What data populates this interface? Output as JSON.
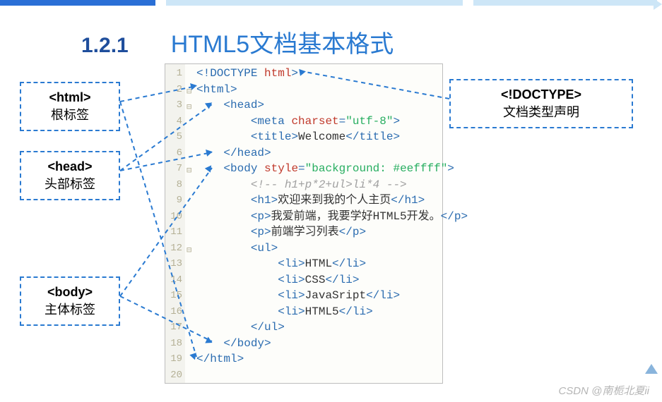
{
  "header": {
    "section_number": "1.2.1",
    "title": "HTML5文档基本格式"
  },
  "callouts": {
    "html": {
      "tag": "<html>",
      "desc": "根标签"
    },
    "head": {
      "tag": "<head>",
      "desc": "头部标签"
    },
    "body": {
      "tag": "<body>",
      "desc": "主体标签"
    },
    "doctype": {
      "tag": "<!DOCTYPE>",
      "desc": "文档类型声明"
    }
  },
  "code": {
    "line_count": 20,
    "fold_markers": [
      2,
      3,
      7,
      12
    ],
    "lines": [
      [
        {
          "c": "t-punc",
          "t": "<!"
        },
        {
          "c": "t-doc",
          "t": "DOCTYPE "
        },
        {
          "c": "t-attr",
          "t": "html"
        },
        {
          "c": "t-punc",
          "t": ">"
        }
      ],
      [
        {
          "c": "t-punc",
          "t": "<"
        },
        {
          "c": "t-tag",
          "t": "html"
        },
        {
          "c": "t-punc",
          "t": ">"
        }
      ],
      [
        {
          "c": "",
          "t": "    "
        },
        {
          "c": "t-punc",
          "t": "<"
        },
        {
          "c": "t-tag",
          "t": "head"
        },
        {
          "c": "t-punc",
          "t": ">"
        }
      ],
      [
        {
          "c": "",
          "t": "        "
        },
        {
          "c": "t-punc",
          "t": "<"
        },
        {
          "c": "t-tag",
          "t": "meta "
        },
        {
          "c": "t-attr",
          "t": "charset"
        },
        {
          "c": "t-punc",
          "t": "="
        },
        {
          "c": "t-str",
          "t": "\"utf-8\""
        },
        {
          "c": "t-punc",
          "t": ">"
        }
      ],
      [
        {
          "c": "",
          "t": "        "
        },
        {
          "c": "t-punc",
          "t": "<"
        },
        {
          "c": "t-tag",
          "t": "title"
        },
        {
          "c": "t-punc",
          "t": ">"
        },
        {
          "c": "t-txt",
          "t": "Welcome"
        },
        {
          "c": "t-punc",
          "t": "</"
        },
        {
          "c": "t-tag",
          "t": "title"
        },
        {
          "c": "t-punc",
          "t": ">"
        }
      ],
      [
        {
          "c": "",
          "t": "    "
        },
        {
          "c": "t-punc",
          "t": "</"
        },
        {
          "c": "t-tag",
          "t": "head"
        },
        {
          "c": "t-punc",
          "t": ">"
        }
      ],
      [
        {
          "c": "",
          "t": "    "
        },
        {
          "c": "t-punc",
          "t": "<"
        },
        {
          "c": "t-tag",
          "t": "body "
        },
        {
          "c": "t-attr",
          "t": "style"
        },
        {
          "c": "t-punc",
          "t": "="
        },
        {
          "c": "t-str",
          "t": "\"background: #eeffff\""
        },
        {
          "c": "t-punc",
          "t": ">"
        }
      ],
      [
        {
          "c": "",
          "t": "        "
        },
        {
          "c": "t-comm",
          "t": "<!-- h1+p*2+ul>li*4 -->"
        }
      ],
      [
        {
          "c": "",
          "t": "        "
        },
        {
          "c": "t-punc",
          "t": "<"
        },
        {
          "c": "t-tag",
          "t": "h1"
        },
        {
          "c": "t-punc",
          "t": ">"
        },
        {
          "c": "t-txt",
          "t": "欢迎来到我的个人主页"
        },
        {
          "c": "t-punc",
          "t": "</"
        },
        {
          "c": "t-tag",
          "t": "h1"
        },
        {
          "c": "t-punc",
          "t": ">"
        }
      ],
      [
        {
          "c": "",
          "t": "        "
        },
        {
          "c": "t-punc",
          "t": "<"
        },
        {
          "c": "t-tag",
          "t": "p"
        },
        {
          "c": "t-punc",
          "t": ">"
        },
        {
          "c": "t-txt",
          "t": "我爱前端，我要学好HTML5开发。"
        },
        {
          "c": "t-punc",
          "t": "</"
        },
        {
          "c": "t-tag",
          "t": "p"
        },
        {
          "c": "t-punc",
          "t": ">"
        }
      ],
      [
        {
          "c": "",
          "t": "        "
        },
        {
          "c": "t-punc",
          "t": "<"
        },
        {
          "c": "t-tag",
          "t": "p"
        },
        {
          "c": "t-punc",
          "t": ">"
        },
        {
          "c": "t-txt",
          "t": "前端学习列表"
        },
        {
          "c": "t-punc",
          "t": "</"
        },
        {
          "c": "t-tag",
          "t": "p"
        },
        {
          "c": "t-punc",
          "t": ">"
        }
      ],
      [
        {
          "c": "",
          "t": "        "
        },
        {
          "c": "t-punc",
          "t": "<"
        },
        {
          "c": "t-tag",
          "t": "ul"
        },
        {
          "c": "t-punc",
          "t": ">"
        }
      ],
      [
        {
          "c": "",
          "t": "            "
        },
        {
          "c": "t-punc",
          "t": "<"
        },
        {
          "c": "t-tag",
          "t": "li"
        },
        {
          "c": "t-punc",
          "t": ">"
        },
        {
          "c": "t-txt",
          "t": "HTML"
        },
        {
          "c": "t-punc",
          "t": "</"
        },
        {
          "c": "t-tag",
          "t": "li"
        },
        {
          "c": "t-punc",
          "t": ">"
        }
      ],
      [
        {
          "c": "",
          "t": "            "
        },
        {
          "c": "t-punc",
          "t": "<"
        },
        {
          "c": "t-tag",
          "t": "li"
        },
        {
          "c": "t-punc",
          "t": ">"
        },
        {
          "c": "t-txt",
          "t": "CSS"
        },
        {
          "c": "t-punc",
          "t": "</"
        },
        {
          "c": "t-tag",
          "t": "li"
        },
        {
          "c": "t-punc",
          "t": ">"
        }
      ],
      [
        {
          "c": "",
          "t": "            "
        },
        {
          "c": "t-punc",
          "t": "<"
        },
        {
          "c": "t-tag",
          "t": "li"
        },
        {
          "c": "t-punc",
          "t": ">"
        },
        {
          "c": "t-txt",
          "t": "JavaSript"
        },
        {
          "c": "t-punc",
          "t": "</"
        },
        {
          "c": "t-tag",
          "t": "li"
        },
        {
          "c": "t-punc",
          "t": ">"
        }
      ],
      [
        {
          "c": "",
          "t": "            "
        },
        {
          "c": "t-punc",
          "t": "<"
        },
        {
          "c": "t-tag",
          "t": "li"
        },
        {
          "c": "t-punc",
          "t": ">"
        },
        {
          "c": "t-txt",
          "t": "HTML5"
        },
        {
          "c": "t-punc",
          "t": "</"
        },
        {
          "c": "t-tag",
          "t": "li"
        },
        {
          "c": "t-punc",
          "t": ">"
        }
      ],
      [
        {
          "c": "",
          "t": "        "
        },
        {
          "c": "t-punc",
          "t": "</"
        },
        {
          "c": "t-tag",
          "t": "ul"
        },
        {
          "c": "t-punc",
          "t": ">"
        }
      ],
      [
        {
          "c": "",
          "t": "    "
        },
        {
          "c": "t-punc",
          "t": "</"
        },
        {
          "c": "t-tag",
          "t": "body"
        },
        {
          "c": "t-punc",
          "t": ">"
        }
      ],
      [
        {
          "c": "t-punc",
          "t": "</"
        },
        {
          "c": "t-tag",
          "t": "html"
        },
        {
          "c": "t-punc",
          "t": ">"
        }
      ],
      [
        {
          "c": "",
          "t": ""
        }
      ]
    ]
  },
  "watermark": "CSDN @南栀北夏ii"
}
